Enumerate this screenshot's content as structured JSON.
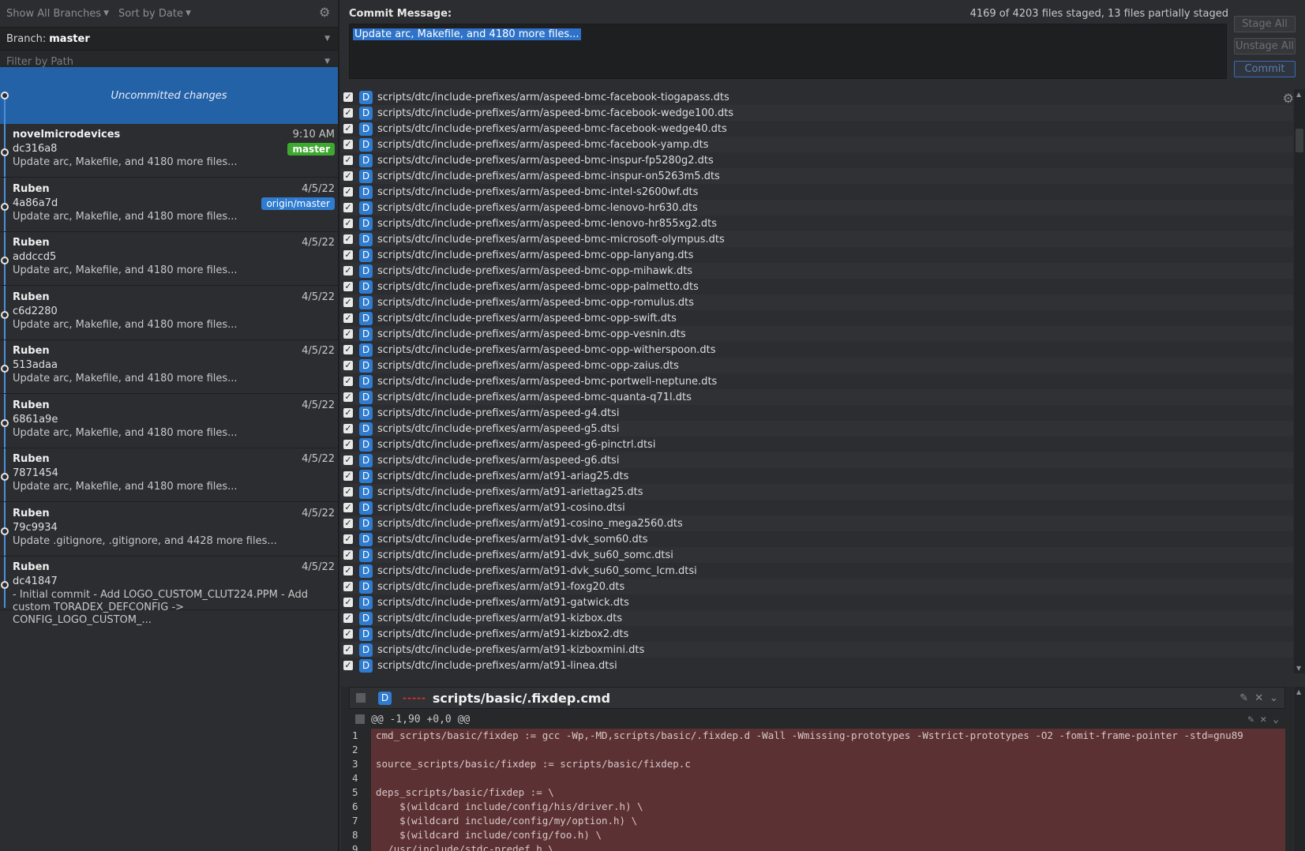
{
  "toolbar": {
    "branches_label": "Show All Branches",
    "sort_label": "Sort by Date"
  },
  "branch": {
    "label": "Branch:",
    "name": "master"
  },
  "filter": {
    "placeholder": "Filter by Path"
  },
  "uncommitted": {
    "label": "Uncommitted changes"
  },
  "commits": [
    {
      "author": "novelmicrodevices",
      "sha": "dc316a8",
      "message": "Update arc, Makefile, and 4180 more files...",
      "date": "9:10 AM",
      "badge": "master"
    },
    {
      "author": "Ruben",
      "sha": "4a86a7d",
      "message": "Update arc, Makefile, and 4180 more files...",
      "date": "4/5/22",
      "badge": "origin/master"
    },
    {
      "author": "Ruben",
      "sha": "addccd5",
      "message": "Update arc, Makefile, and 4180 more files...",
      "date": "4/5/22"
    },
    {
      "author": "Ruben",
      "sha": "c6d2280",
      "message": "Update arc, Makefile, and 4180 more files...",
      "date": "4/5/22"
    },
    {
      "author": "Ruben",
      "sha": "513adaa",
      "message": "Update arc, Makefile, and 4180 more files...",
      "date": "4/5/22"
    },
    {
      "author": "Ruben",
      "sha": "6861a9e",
      "message": "Update arc, Makefile, and 4180 more files...",
      "date": "4/5/22"
    },
    {
      "author": "Ruben",
      "sha": "7871454",
      "message": "Update arc, Makefile, and 4180 more files...",
      "date": "4/5/22"
    },
    {
      "author": "Ruben",
      "sha": "79c9934",
      "message": "Update .gitignore, .gitignore, and 4428 more files...",
      "date": "4/5/22"
    },
    {
      "author": "Ruben",
      "sha": "dc41847",
      "message": "- Initial commit - Add LOGO_CUSTOM_CLUT224.PPM - Add custom TORADEX_DEFCONFIG -> CONFIG_LOGO_CUSTOM_...",
      "date": "4/5/22"
    }
  ],
  "commit_panel": {
    "label": "Commit Message:",
    "staged_status": "4169 of 4203 files staged, 13 files partially staged",
    "message": "Update arc, Makefile, and 4180 more files...",
    "stage_all": "Stage All",
    "unstage_all": "Unstage All",
    "commit": "Commit"
  },
  "files": [
    "scripts/dtc/include-prefixes/arm/aspeed-bmc-facebook-tiogapass.dts",
    "scripts/dtc/include-prefixes/arm/aspeed-bmc-facebook-wedge100.dts",
    "scripts/dtc/include-prefixes/arm/aspeed-bmc-facebook-wedge40.dts",
    "scripts/dtc/include-prefixes/arm/aspeed-bmc-facebook-yamp.dts",
    "scripts/dtc/include-prefixes/arm/aspeed-bmc-inspur-fp5280g2.dts",
    "scripts/dtc/include-prefixes/arm/aspeed-bmc-inspur-on5263m5.dts",
    "scripts/dtc/include-prefixes/arm/aspeed-bmc-intel-s2600wf.dts",
    "scripts/dtc/include-prefixes/arm/aspeed-bmc-lenovo-hr630.dts",
    "scripts/dtc/include-prefixes/arm/aspeed-bmc-lenovo-hr855xg2.dts",
    "scripts/dtc/include-prefixes/arm/aspeed-bmc-microsoft-olympus.dts",
    "scripts/dtc/include-prefixes/arm/aspeed-bmc-opp-lanyang.dts",
    "scripts/dtc/include-prefixes/arm/aspeed-bmc-opp-mihawk.dts",
    "scripts/dtc/include-prefixes/arm/aspeed-bmc-opp-palmetto.dts",
    "scripts/dtc/include-prefixes/arm/aspeed-bmc-opp-romulus.dts",
    "scripts/dtc/include-prefixes/arm/aspeed-bmc-opp-swift.dts",
    "scripts/dtc/include-prefixes/arm/aspeed-bmc-opp-vesnin.dts",
    "scripts/dtc/include-prefixes/arm/aspeed-bmc-opp-witherspoon.dts",
    "scripts/dtc/include-prefixes/arm/aspeed-bmc-opp-zaius.dts",
    "scripts/dtc/include-prefixes/arm/aspeed-bmc-portwell-neptune.dts",
    "scripts/dtc/include-prefixes/arm/aspeed-bmc-quanta-q71l.dts",
    "scripts/dtc/include-prefixes/arm/aspeed-g4.dtsi",
    "scripts/dtc/include-prefixes/arm/aspeed-g5.dtsi",
    "scripts/dtc/include-prefixes/arm/aspeed-g6-pinctrl.dtsi",
    "scripts/dtc/include-prefixes/arm/aspeed-g6.dtsi",
    "scripts/dtc/include-prefixes/arm/at91-ariag25.dts",
    "scripts/dtc/include-prefixes/arm/at91-ariettag25.dts",
    "scripts/dtc/include-prefixes/arm/at91-cosino.dtsi",
    "scripts/dtc/include-prefixes/arm/at91-cosino_mega2560.dts",
    "scripts/dtc/include-prefixes/arm/at91-dvk_som60.dts",
    "scripts/dtc/include-prefixes/arm/at91-dvk_su60_somc.dtsi",
    "scripts/dtc/include-prefixes/arm/at91-dvk_su60_somc_lcm.dtsi",
    "scripts/dtc/include-prefixes/arm/at91-foxg20.dts",
    "scripts/dtc/include-prefixes/arm/at91-gatwick.dts",
    "scripts/dtc/include-prefixes/arm/at91-kizbox.dts",
    "scripts/dtc/include-prefixes/arm/at91-kizbox2.dts",
    "scripts/dtc/include-prefixes/arm/at91-kizboxmini.dts",
    "scripts/dtc/include-prefixes/arm/at91-linea.dtsi"
  ],
  "file_status": "D",
  "diff": {
    "status": "D",
    "filename": "scripts/basic/.fixdep.cmd",
    "hunk": "@@ -1,90 +0,0 @@",
    "lines": [
      {
        "n": "1",
        "text": "cmd_scripts/basic/fixdep := gcc -Wp,-MD,scripts/basic/.fixdep.d -Wall -Wmissing-prototypes -Wstrict-prototypes -O2 -fomit-frame-pointer -std=gnu89"
      },
      {
        "n": "2",
        "text": ""
      },
      {
        "n": "3",
        "text": "source_scripts/basic/fixdep := scripts/basic/fixdep.c"
      },
      {
        "n": "4",
        "text": ""
      },
      {
        "n": "5",
        "text": "deps_scripts/basic/fixdep := \\"
      },
      {
        "n": "6",
        "text": "    $(wildcard include/config/his/driver.h) \\"
      },
      {
        "n": "7",
        "text": "    $(wildcard include/config/my/option.h) \\"
      },
      {
        "n": "8",
        "text": "    $(wildcard include/config/foo.h) \\"
      },
      {
        "n": "9",
        "text": "  /usr/include/stdc-predef.h \\"
      }
    ]
  },
  "colors": {
    "selection": "#2462a8",
    "accent": "#2e7bd0",
    "master_badge": "#3ea830",
    "deleted_bg": "#5c3134"
  }
}
